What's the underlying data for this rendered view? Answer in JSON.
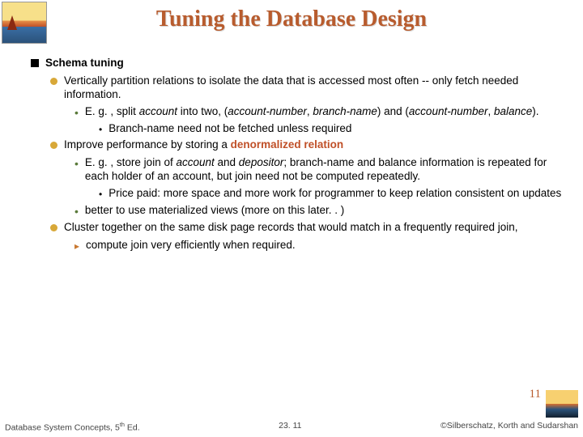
{
  "title": "Tuning the Database Design",
  "body": {
    "h1": "Schema tuning",
    "p1": "Vertically partition relations to isolate the data that is accessed most often -- only fetch needed information.",
    "p1a_pre": "E. g. , split ",
    "p1a_acc": "account",
    "p1a_mid": " into two, (",
    "p1a_an": "account-number",
    "p1a_c1": ", ",
    "p1a_bn": "branch-name",
    "p1a_mid2": ") and (",
    "p1a_an2": "account-number",
    "p1a_c2": ", ",
    "p1a_bal": "balance",
    "p1a_end": ").",
    "p1b": "Branch-name need not be fetched unless required",
    "p2_pre": "Improve performance by storing a ",
    "p2_denorm": "denormalized relation",
    "p2a_pre": "E. g. , store join of ",
    "p2a_acc": "account",
    "p2a_and": " and ",
    "p2a_dep": "depositor",
    "p2a_rest": "; branch-name and balance information is repeated for each holder of  an account, but join need not be computed repeatedly.",
    "p2b": "Price paid:  more space and more work for programmer to keep relation consistent on updates",
    "p2c": "better to use materialized views (more on this later. . )",
    "p3": "Cluster together on the same disk page records that would match in a frequently required join,",
    "p3a": "compute join very efficiently when required."
  },
  "slidenum": "11",
  "footer": {
    "left_pre": "Database System Concepts, 5",
    "left_sup": "th",
    "left_post": " Ed.",
    "center": "23. 11",
    "right": "©Silberschatz, Korth and Sudarshan"
  }
}
